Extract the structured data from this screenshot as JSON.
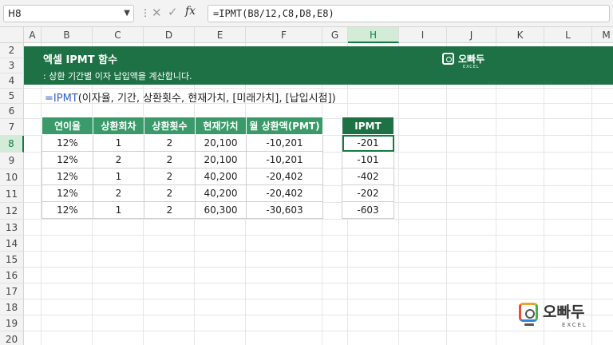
{
  "formula_bar": {
    "name_box": "H8",
    "fx_label": "fx",
    "formula": "=IPMT(B8/12,C8,D8,E8)"
  },
  "columns": [
    "A",
    "B",
    "C",
    "D",
    "E",
    "F",
    "G",
    "H",
    "I",
    "J",
    "K",
    "L",
    "M"
  ],
  "rows": [
    "2",
    "3",
    "4",
    "5",
    "6",
    "7",
    "8",
    "9",
    "10",
    "11",
    "12",
    "13",
    "14",
    "15",
    "16",
    "17",
    "18",
    "19",
    "20"
  ],
  "selected_cell": {
    "column": "H",
    "row": "8"
  },
  "banner": {
    "title": "엑셀 IPMT 함수",
    "subtitle": ": 상환 기간별 이자 납입액을 계산합니다.",
    "logo_text": "오빠두",
    "logo_sub": "EXCEL"
  },
  "syntax": {
    "fn": "=IPMT",
    "args": "(이자율, 기간, 상환횟수, 현재가치, [미래가치], [납입시점])"
  },
  "table": {
    "headers": [
      "연이율",
      "상환회차",
      "상환횟수",
      "현재가치",
      "월 상환액(PMT)"
    ],
    "rows": [
      [
        "12%",
        "1",
        "2",
        "20,100",
        "-10,201"
      ],
      [
        "12%",
        "2",
        "2",
        "20,100",
        "-10,201"
      ],
      [
        "12%",
        "1",
        "2",
        "40,200",
        "-20,402"
      ],
      [
        "12%",
        "2",
        "2",
        "40,200",
        "-20,402"
      ],
      [
        "12%",
        "1",
        "2",
        "60,300",
        "-30,603"
      ]
    ]
  },
  "ipmt_table": {
    "header": "IPMT",
    "values": [
      "-201",
      "-101",
      "-402",
      "-202",
      "-603"
    ]
  },
  "bottom_logo": {
    "text": "오빠두",
    "sub": "EXCEL"
  },
  "colors": {
    "banner": "#1e7145",
    "header_green": "#3a9a6a",
    "excel_accent": "#107c41",
    "function_blue": "#2f5fd0"
  }
}
